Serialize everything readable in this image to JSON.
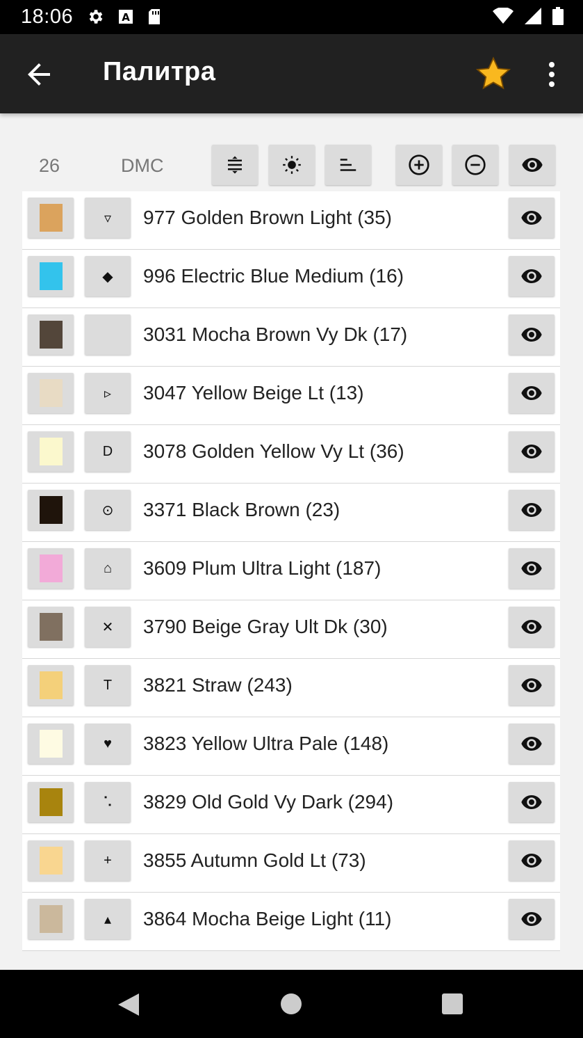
{
  "status_bar": {
    "time": "18:06",
    "left_icons": [
      "gear-icon",
      "a-box-icon",
      "sd-card-icon"
    ],
    "right_icons": [
      "wifi-icon",
      "signal-icon",
      "battery-icon"
    ]
  },
  "app_bar": {
    "title": "Палитра",
    "back_icon": "arrow-left-icon",
    "favorite_icon": "star-icon",
    "menu_icon": "more-vert-icon"
  },
  "toolbar": {
    "count": "26",
    "brand": "DMC",
    "buttons": [
      "sort-by-code-icon",
      "sort-by-brightness-icon",
      "sort-by-count-icon",
      "add-circle-icon",
      "remove-circle-icon",
      "eye-icon"
    ]
  },
  "palette": [
    {
      "label": "977 Golden Brown Light  (35)",
      "color": "#dba35d",
      "symbol": "▿"
    },
    {
      "label": "996 Electric Blue Medium  (16)",
      "color": "#33c3ec",
      "symbol": "◆"
    },
    {
      "label": "3031 Mocha Brown Vy Dk  (17)",
      "color": "#53463a",
      "symbol": ""
    },
    {
      "label": "3047 Yellow Beige Lt  (13)",
      "color": "#e8dbc4",
      "symbol": "▹"
    },
    {
      "label": "3078 Golden Yellow Vy Lt  (36)",
      "color": "#fbf8cd",
      "symbol": "D"
    },
    {
      "label": "3371 Black Brown  (23)",
      "color": "#1f140b",
      "symbol": "⊙"
    },
    {
      "label": "3609 Plum Ultra Light  (187)",
      "color": "#f2aad8",
      "symbol": "⌂"
    },
    {
      "label": "3790 Beige Gray Ult Dk  (30)",
      "color": "#807060",
      "symbol": "✕"
    },
    {
      "label": "3821 Straw  (243)",
      "color": "#f4d07a",
      "symbol": "T"
    },
    {
      "label": "3823 Yellow Ultra Pale  (148)",
      "color": "#fefbe3",
      "symbol": "♥"
    },
    {
      "label": "3829 Old Gold Vy Dark  (294)",
      "color": "#a8840e",
      "symbol": "⠡"
    },
    {
      "label": "3855 Autumn Gold Lt  (73)",
      "color": "#f9d690",
      "symbol": "+"
    },
    {
      "label": "3864 Mocha Beige Light  (11)",
      "color": "#cbb89c",
      "symbol": "▴"
    }
  ],
  "nav_bar": {
    "icons": [
      "back-triangle-icon",
      "home-circle-icon",
      "recents-square-icon"
    ]
  }
}
